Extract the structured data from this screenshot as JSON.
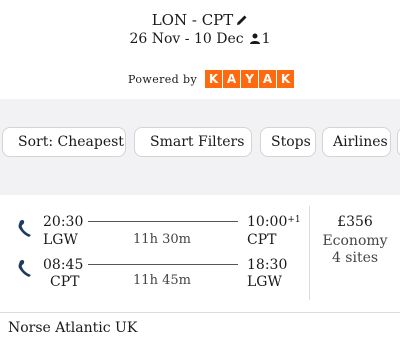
{
  "header": {
    "route": "LON - CPT",
    "dates": "26 Nov - 10 Dec",
    "travellers": "1",
    "powered_by": "Powered by",
    "brand_letters": [
      "K",
      "A",
      "Y",
      "A",
      "K"
    ]
  },
  "filters": {
    "sort_label": "Sort: Cheapest",
    "smart_filters_label": "Smart Filters",
    "stops_label": "Stops",
    "airlines_label": "Airlines"
  },
  "result": {
    "outbound": {
      "depart_time": "20:30",
      "depart_airport": "LGW",
      "duration": "11h 30m",
      "arrive_time": "10:00",
      "day_offset": "+1",
      "arrive_airport": "CPT"
    },
    "inbound": {
      "depart_time": "08:45",
      "depart_airport": "CPT",
      "duration": "11h 45m",
      "arrive_time": "18:30",
      "arrive_airport": "LGW"
    },
    "price": "£356",
    "cabin": "Economy",
    "sites": "4 sites",
    "airline": "Norse Atlantic UK"
  },
  "colors": {
    "brand_orange": "#ff690f",
    "airline_logo": "#1e3a5f",
    "filter_background": "#f2f2f4"
  },
  "icons": [
    "edit-pencil-icon",
    "person-icon",
    "sort-icon",
    "sparkle-icon",
    "norse-logo-icon"
  ]
}
